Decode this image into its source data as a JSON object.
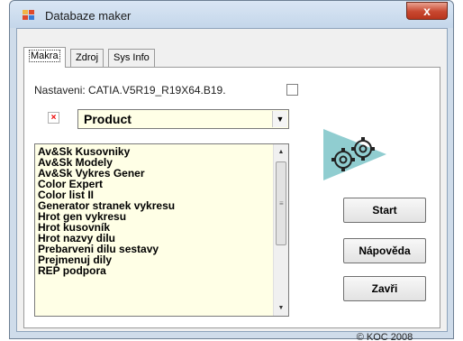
{
  "window": {
    "title": "Databaze maker",
    "close_label": "x"
  },
  "tabs": [
    {
      "label": "Makra",
      "active": true
    },
    {
      "label": "Zdroj",
      "active": false
    },
    {
      "label": "Sys Info",
      "active": false
    }
  ],
  "settings": {
    "label": "Nastaveni:  CATIA.V5R19_R19X64.B19.",
    "checked": false
  },
  "remove_icon_glyph": "×",
  "combo": {
    "selected": "Product",
    "arrow": "▼"
  },
  "macro_list": {
    "items": [
      "Av&Sk Kusovniky",
      "Av&Sk Modely",
      "Av&Sk Vykres Gener",
      "Color Expert",
      "Color list II",
      "Generator stranek vykresu",
      "Hrot gen vykresu",
      "Hrot kusovník",
      "Hrot nazvy dilu",
      "Prebarveni dilu sestavy",
      "Prejmenuj dily",
      "REP podpora"
    ]
  },
  "buttons": {
    "start": "Start",
    "help": "Nápověda",
    "close": "Zavři"
  },
  "copyright": "© KOC 2008",
  "colors": {
    "list_background": "#ffffe6",
    "gear_accent": "#7dc4c8"
  }
}
